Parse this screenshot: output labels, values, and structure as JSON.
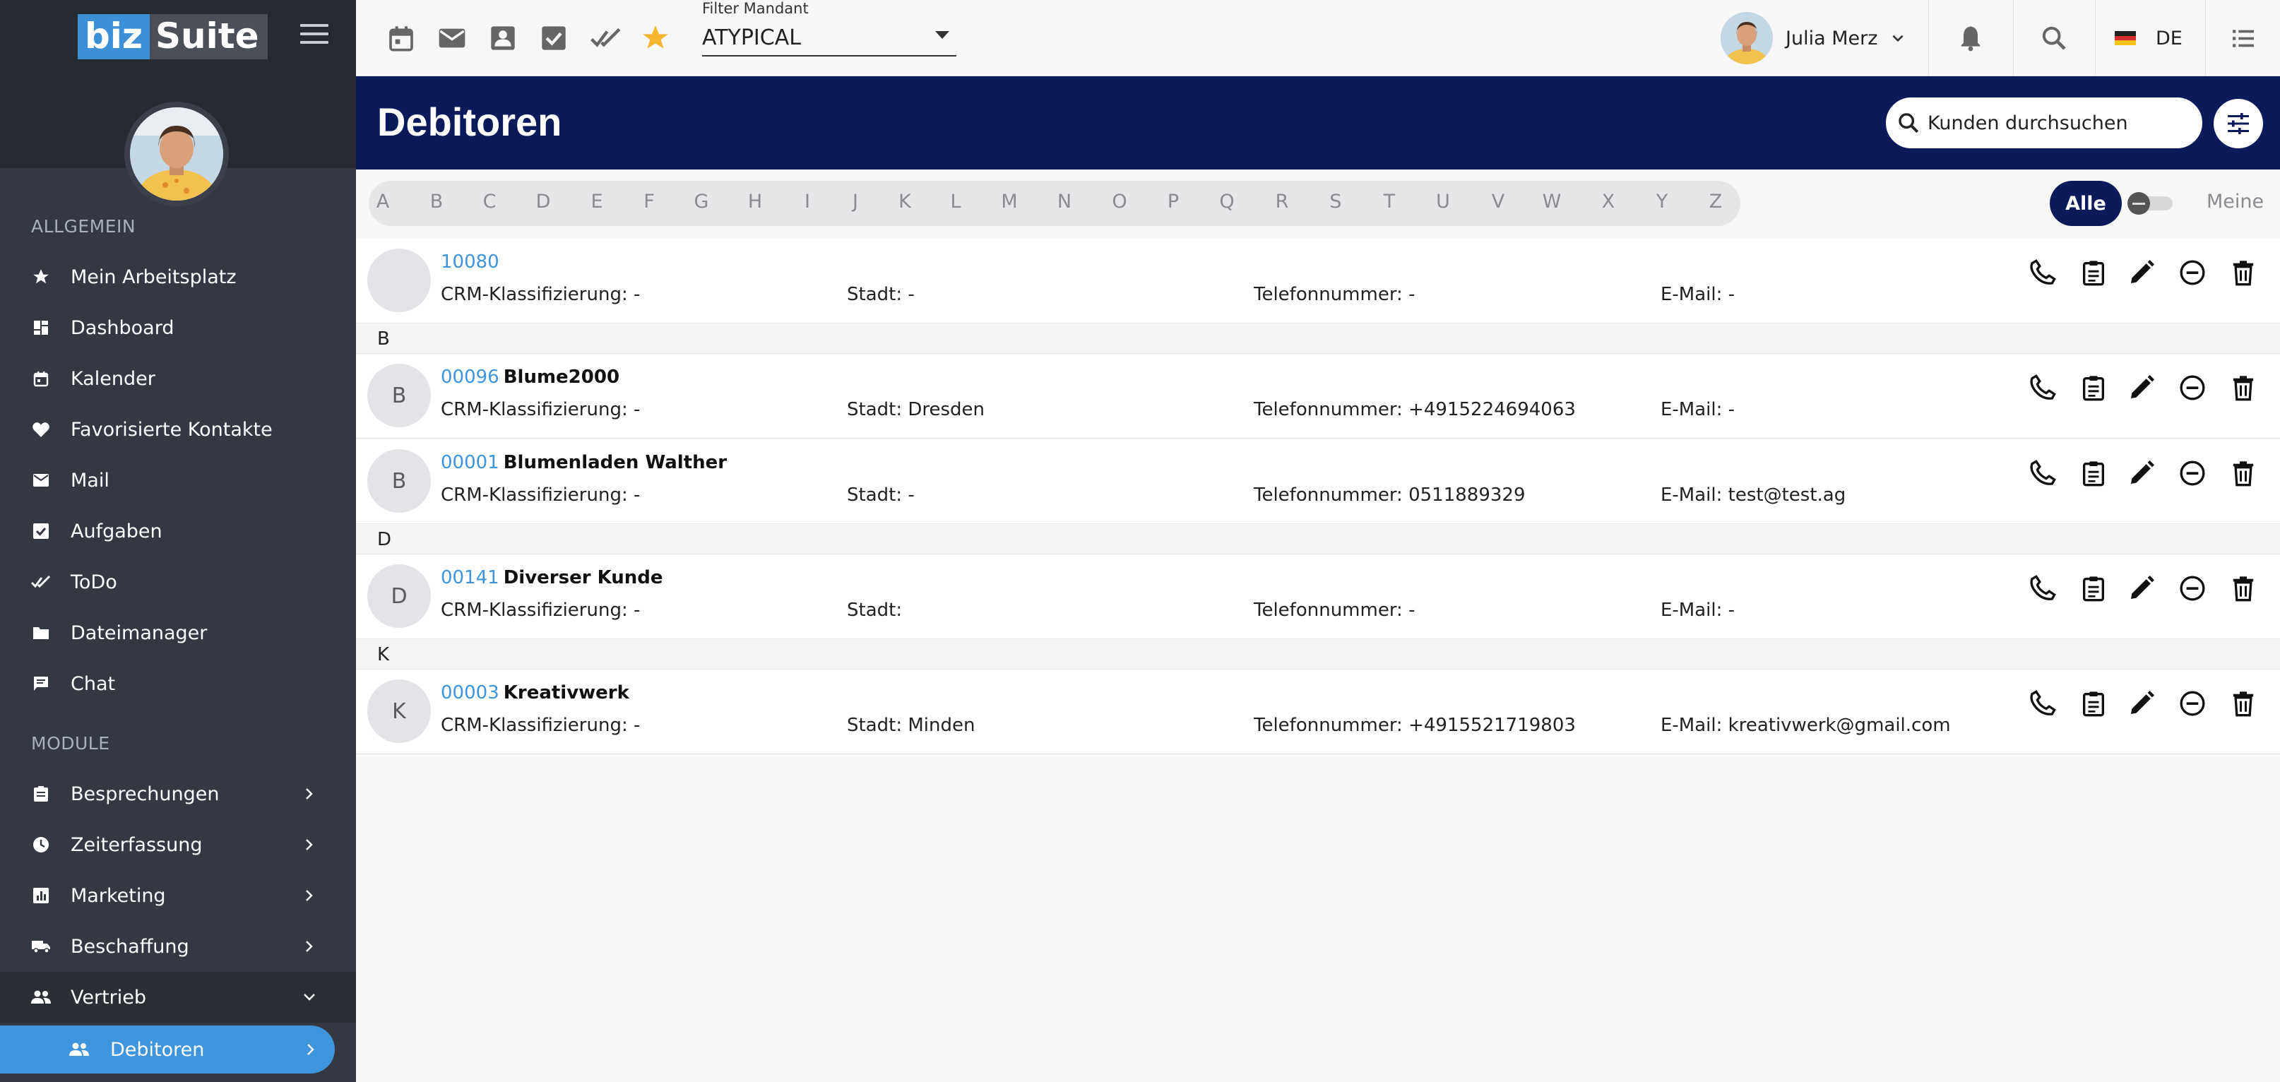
{
  "logo": {
    "part1": "biz",
    "part2": "Suite"
  },
  "sidebar": {
    "section_general": "ALLGEMEIN",
    "general_items": [
      {
        "label": "Mein Arbeitsplatz",
        "icon": "star-icon"
      },
      {
        "label": "Dashboard",
        "icon": "dashboard-icon"
      },
      {
        "label": "Kalender",
        "icon": "calendar-icon"
      },
      {
        "label": "Favorisierte Kontakte",
        "icon": "heart-icon"
      },
      {
        "label": "Mail",
        "icon": "mail-icon"
      },
      {
        "label": "Aufgaben",
        "icon": "checkbox-icon"
      },
      {
        "label": "ToDo",
        "icon": "double-check-icon"
      },
      {
        "label": "Dateimanager",
        "icon": "folder-icon"
      },
      {
        "label": "Chat",
        "icon": "chat-icon"
      }
    ],
    "section_modules": "MODULE",
    "module_items": [
      {
        "label": "Besprechungen",
        "icon": "clipboard-icon"
      },
      {
        "label": "Zeiterfassung",
        "icon": "clock-icon"
      },
      {
        "label": "Marketing",
        "icon": "bar-chart-icon"
      },
      {
        "label": "Beschaffung",
        "icon": "truck-icon"
      },
      {
        "label": "Vertrieb",
        "icon": "people-icon"
      }
    ],
    "active_item": {
      "label": "Debitoren",
      "icon": "people-icon"
    }
  },
  "topbar": {
    "icons": [
      "calendar-icon",
      "mail-icon",
      "contact-icon",
      "checkbox-icon",
      "double-check-icon",
      "star-icon"
    ],
    "filter_label": "Filter Mandant",
    "filter_value": "ATYPICAL",
    "user_name": "Julia Merz",
    "language": "DE"
  },
  "header": {
    "title": "Debitoren",
    "search_placeholder": "Kunden durchsuchen"
  },
  "alphabet": [
    "A",
    "B",
    "C",
    "D",
    "E",
    "F",
    "G",
    "H",
    "I",
    "J",
    "K",
    "L",
    "M",
    "N",
    "O",
    "P",
    "Q",
    "R",
    "S",
    "T",
    "U",
    "V",
    "W",
    "X",
    "Y",
    "Z"
  ],
  "segment": {
    "all_label": "Alle",
    "mine_label": "Meine"
  },
  "colors": {
    "accent": "#3e95dc",
    "header_bg": "#0b1a5a",
    "sidebar_bg": "#333842",
    "star": "#f5b52e"
  },
  "list": {
    "groups": [
      {
        "letter": "",
        "rows": [
          {
            "initial": "",
            "number": "10080",
            "name": "",
            "crm": "CRM-Klassifizierung: -",
            "city": "Stadt: -",
            "phone": "Telefonnummer: -",
            "email": "E-Mail: -"
          }
        ]
      },
      {
        "letter": "B",
        "rows": [
          {
            "initial": "B",
            "number": "00096",
            "name": "Blume2000",
            "crm": "CRM-Klassifizierung: -",
            "city": "Stadt: Dresden",
            "phone": "Telefonnummer: +4915224694063",
            "email": "E-Mail: -"
          },
          {
            "initial": "B",
            "number": "00001",
            "name": "Blumenladen Walther",
            "crm": "CRM-Klassifizierung: -",
            "city": "Stadt: -",
            "phone": "Telefonnummer: 0511889329",
            "email": "E-Mail: test@test.ag"
          }
        ]
      },
      {
        "letter": "D",
        "rows": [
          {
            "initial": "D",
            "number": "00141",
            "name": "Diverser Kunde",
            "crm": "CRM-Klassifizierung: -",
            "city": "Stadt:",
            "phone": "Telefonnummer: -",
            "email": "E-Mail: -"
          }
        ]
      },
      {
        "letter": "K",
        "rows": [
          {
            "initial": "K",
            "number": "00003",
            "name": "Kreativwerk",
            "crm": "CRM-Klassifizierung: -",
            "city": "Stadt: Minden",
            "phone": "Telefonnummer: +4915521719803",
            "email": "E-Mail: kreativwerk@gmail.com"
          }
        ]
      }
    ],
    "row_actions": [
      "phone-icon",
      "clipboard-icon",
      "pencil-icon",
      "minus-circle-icon",
      "trash-icon"
    ]
  }
}
